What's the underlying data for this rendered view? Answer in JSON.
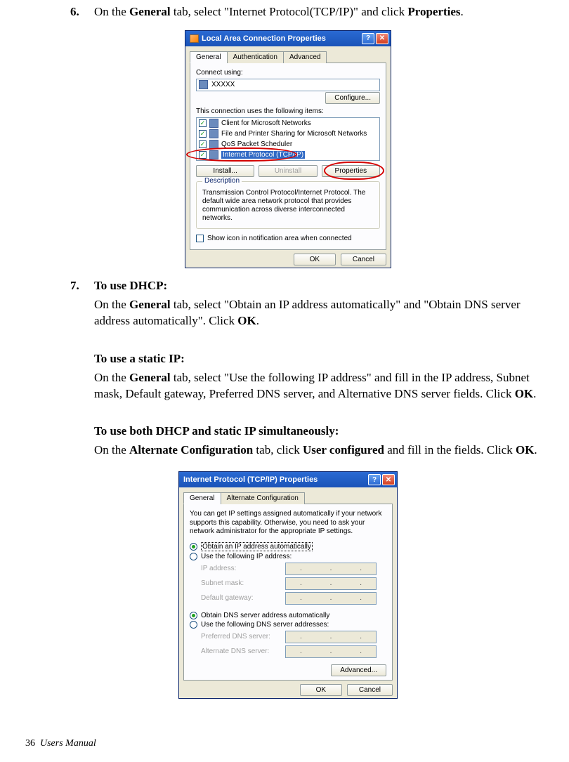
{
  "step6": {
    "num": "6.",
    "text_a": "On the ",
    "text_b": "General",
    "text_c": " tab, select \"Internet Protocol(TCP/IP)\" and click ",
    "text_d": "Properties",
    "text_e": "."
  },
  "dlg1": {
    "title": "Local Area Connection Properties",
    "tabs": {
      "general": "General",
      "auth": "Authentication",
      "adv": "Advanced"
    },
    "connect_using": "Connect using:",
    "adapter": "XXXXX",
    "configure": "Configure...",
    "uses_label": "This connection uses the following items:",
    "items": {
      "a": "Client for Microsoft Networks",
      "b": "File and Printer Sharing for Microsoft Networks",
      "c": "QoS Packet Scheduler",
      "d": "Internet Protocol (TCP/IP)"
    },
    "install": "Install...",
    "uninstall": "Uninstall",
    "properties": "Properties",
    "desc_legend": "Description",
    "desc_text": "Transmission Control Protocol/Internet Protocol. The default wide area network protocol that provides communication across diverse interconnected networks.",
    "show_icon": "Show icon in notification area when connected",
    "ok": "OK",
    "cancel": "Cancel"
  },
  "step7": {
    "num": "7.",
    "h1": "To use DHCP:",
    "p1a": "On the ",
    "p1b": "General",
    "p1c": " tab, select \"Obtain an IP address automatically\" and \"Obtain DNS server address automatically\". Click ",
    "p1d": "OK",
    "p1e": ".",
    "h2": "To use a static IP:",
    "p2a": "On the ",
    "p2b": "General",
    "p2c": " tab, select \"Use the following IP address\" and fill in the IP address, Subnet mask, Default gateway, Preferred DNS server, and Alternative DNS server fields. Click ",
    "p2d": "OK",
    "p2e": ".",
    "h3": "To use both DHCP and static IP simultaneously:",
    "p3a": "On the ",
    "p3b": "Alternate Configuration",
    "p3c": " tab, click ",
    "p3d": "User configured",
    "p3e": " and fill in the fields. Click ",
    "p3f": "OK",
    "p3g": "."
  },
  "dlg2": {
    "title": "Internet Protocol (TCP/IP) Properties",
    "tabs": {
      "general": "General",
      "alt": "Alternate Configuration"
    },
    "blurb": "You can get IP settings assigned automatically if your network supports this capability. Otherwise, you need to ask your network administrator for the appropriate IP settings.",
    "r_obtain_ip": "Obtain an IP address automatically",
    "r_use_ip": "Use the following IP address:",
    "ipaddr": "IP address:",
    "subnet": "Subnet mask:",
    "gateway": "Default gateway:",
    "r_obtain_dns": "Obtain DNS server address automatically",
    "r_use_dns": "Use the following DNS server addresses:",
    "pref_dns": "Preferred DNS server:",
    "alt_dns": "Alternate DNS server:",
    "advanced": "Advanced...",
    "ok": "OK",
    "cancel": "Cancel"
  },
  "footer": {
    "pagenum": "36",
    "title": "Users Manual"
  }
}
